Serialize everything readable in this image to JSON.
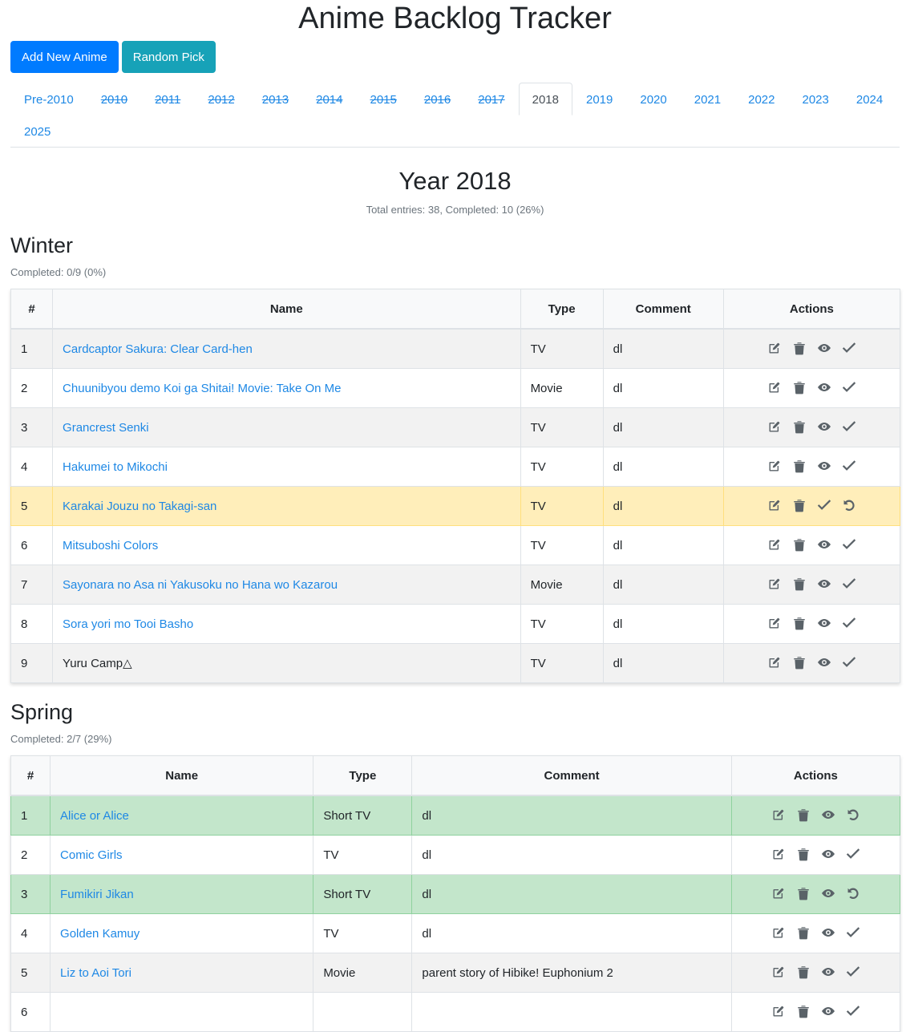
{
  "app_title": "Anime Backlog Tracker",
  "buttons": {
    "add": "Add New Anime",
    "random": "Random Pick"
  },
  "tabs": [
    {
      "label": "Pre-2010",
      "state": "normal"
    },
    {
      "label": "2010",
      "state": "done"
    },
    {
      "label": "2011",
      "state": "done"
    },
    {
      "label": "2012",
      "state": "done"
    },
    {
      "label": "2013",
      "state": "done"
    },
    {
      "label": "2014",
      "state": "done"
    },
    {
      "label": "2015",
      "state": "done"
    },
    {
      "label": "2016",
      "state": "done"
    },
    {
      "label": "2017",
      "state": "done"
    },
    {
      "label": "2018",
      "state": "active"
    },
    {
      "label": "2019",
      "state": "normal"
    },
    {
      "label": "2020",
      "state": "normal"
    },
    {
      "label": "2021",
      "state": "normal"
    },
    {
      "label": "2022",
      "state": "normal"
    },
    {
      "label": "2023",
      "state": "normal"
    },
    {
      "label": "2024",
      "state": "normal"
    },
    {
      "label": "2025",
      "state": "normal"
    }
  ],
  "year": {
    "title": "Year 2018",
    "stats": "Total entries: 38, Completed: 10 (26%)"
  },
  "columns": [
    "#",
    "Name",
    "Type",
    "Comment",
    "Actions"
  ],
  "colors": {
    "link": "#1e88e5",
    "primary": "#007bff",
    "info": "#17a2b8",
    "watching_row": "#ffeeba",
    "completed_row": "#c3e6cb"
  },
  "seasons": [
    {
      "title": "Winter",
      "stats": "Completed: 0/9 (0%)",
      "col_widths": [
        52,
        583,
        103,
        150,
        220
      ],
      "rows": [
        {
          "num": "1",
          "name": "Cardcaptor Sakura: Clear Card-hen",
          "type": "TV",
          "comment": "dl",
          "status": "none",
          "link": true
        },
        {
          "num": "2",
          "name": "Chuunibyou demo Koi ga Shitai! Movie: Take On Me",
          "type": "Movie",
          "comment": "dl",
          "status": "none",
          "link": true
        },
        {
          "num": "3",
          "name": "Grancrest Senki",
          "type": "TV",
          "comment": "dl",
          "status": "none",
          "link": true
        },
        {
          "num": "4",
          "name": "Hakumei to Mikochi",
          "type": "TV",
          "comment": "dl",
          "status": "none",
          "link": true
        },
        {
          "num": "5",
          "name": "Karakai Jouzu no Takagi-san",
          "type": "TV",
          "comment": "dl",
          "status": "watching",
          "link": true
        },
        {
          "num": "6",
          "name": "Mitsuboshi Colors",
          "type": "TV",
          "comment": "dl",
          "status": "none",
          "link": true
        },
        {
          "num": "7",
          "name": "Sayonara no Asa ni Yakusoku no Hana wo Kazarou",
          "type": "Movie",
          "comment": "dl",
          "status": "none",
          "link": true
        },
        {
          "num": "8",
          "name": "Sora yori mo Tooi Basho",
          "type": "TV",
          "comment": "dl",
          "status": "none",
          "link": true
        },
        {
          "num": "9",
          "name": "Yuru Camp△",
          "type": "TV",
          "comment": "dl",
          "status": "none",
          "link": false
        }
      ]
    },
    {
      "title": "Spring",
      "stats": "Completed: 2/7 (29%)",
      "col_widths": [
        49,
        328,
        123,
        398,
        210
      ],
      "rows": [
        {
          "num": "1",
          "name": "Alice or Alice",
          "type": "Short TV",
          "comment": "dl",
          "status": "completed",
          "link": true
        },
        {
          "num": "2",
          "name": "Comic Girls",
          "type": "TV",
          "comment": "dl",
          "status": "none",
          "link": true
        },
        {
          "num": "3",
          "name": "Fumikiri Jikan",
          "type": "Short TV",
          "comment": "dl",
          "status": "completed",
          "link": true
        },
        {
          "num": "4",
          "name": "Golden Kamuy",
          "type": "TV",
          "comment": "dl",
          "status": "none",
          "link": true
        },
        {
          "num": "5",
          "name": "Liz to Aoi Tori",
          "type": "Movie",
          "comment": "parent story of Hibike! Euphonium 2",
          "status": "none",
          "link": true
        },
        {
          "num": "6",
          "name": "",
          "type": "",
          "comment": "",
          "status": "none",
          "link": true
        }
      ]
    }
  ]
}
